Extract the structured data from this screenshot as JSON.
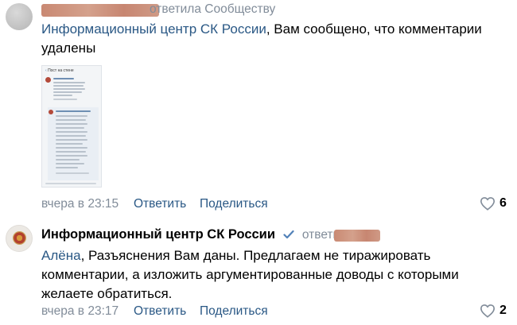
{
  "comment1": {
    "author_suffix": "ответила Сообществу",
    "reply_to": "Информационный центр СК России",
    "text": ", Вам сообщено, что комментарии удалены",
    "thumbnail": {
      "header": "Пост на стене"
    },
    "time": "вчера в 23:15",
    "reply_label": "Ответить",
    "share_label": "Поделиться",
    "likes": "6"
  },
  "comment2": {
    "author": "Информационный центр СК России",
    "author_suffix": "ответил",
    "reply_to": "Алёна",
    "text": ", Разъяснения Вам даны. Предлагаем не тиражировать комментарии, а изложить аргументированные доводы с которыми желаете обратиться.",
    "time": "вчера в 23:17",
    "reply_label": "Ответить",
    "share_label": "Поделиться",
    "likes": "2"
  },
  "colors": {
    "link": "#2a5885",
    "meta": "#818c99",
    "verified": "#5181b8",
    "redaction": "#cf9a86"
  }
}
